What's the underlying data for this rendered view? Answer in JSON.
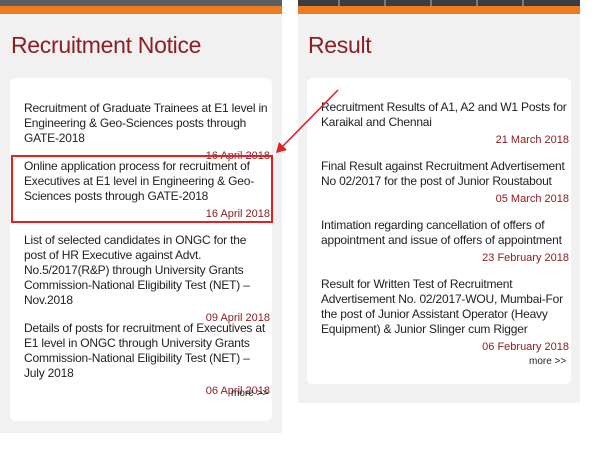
{
  "recruitment": {
    "title": "Recruitment Notice",
    "items": [
      {
        "title": "Recruitment of Graduate Trainees at E1 level in Engineering & Geo-Sciences posts through GATE-2018",
        "date": "16 April 2018"
      },
      {
        "title": "Online application process for recruitment of Executives at E1 level in Engineering & Geo-Sciences posts through GATE-2018",
        "date": "16 April 2018"
      },
      {
        "title": "List of selected candidates in ONGC for the post of HR Executive against Advt. No.5/2017(R&P) through University Grants Commission-National Eligibility Test (NET) –Nov.2018",
        "date": "09 April 2018"
      },
      {
        "title": "Details of posts for recruitment of Executives at E1 level in ONGC through University Grants Commission-National Eligibility Test (NET) –July 2018",
        "date": "06 April 2018"
      }
    ],
    "more": "more >>"
  },
  "result": {
    "title": "Result",
    "items": [
      {
        "title": "Recruitment Results of A1, A2 and W1 Posts for Karaikal and Chennai",
        "date": "21 March 2018"
      },
      {
        "title": "Final Result against Recruitment Advertisement No 02/2017 for the post of Junior Roustabout",
        "date": "05 March 2018"
      },
      {
        "title": "Intimation regarding cancellation of offers of appointment and issue of offers of appointment",
        "date": "23 February 2018"
      },
      {
        "title": "Result for Written Test of Recruitment Advertisement No. 02/2017-WOU, Mumbai-For the post of Junior Assistant Operator (Heavy Equipment) & Junior Slinger cum Rigger",
        "date": "06 February 2018"
      }
    ],
    "more": "more >>"
  },
  "colors": {
    "accent_orange": "#ee7d22",
    "title_red": "#8b1f23",
    "highlight_red": "#e02222",
    "panel_bg": "#f2f1f1"
  }
}
